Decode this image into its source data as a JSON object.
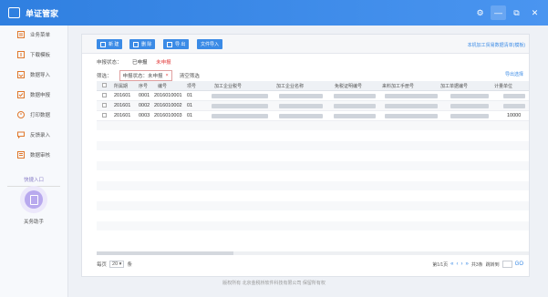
{
  "app": {
    "title": "单证管家",
    "colors": {
      "primary": "#3b8be6",
      "accent_red": "#e23b3b",
      "quick_purple": "#b8a9ee"
    }
  },
  "window_controls": [
    "gear-icon",
    "minimize-icon",
    "restore-icon",
    "close-icon"
  ],
  "sidebar": {
    "items": [
      {
        "label": "业务菜单",
        "icon": "menu-icon"
      },
      {
        "label": "下载模板",
        "icon": "download-icon"
      },
      {
        "label": "数据导入",
        "icon": "import-icon"
      },
      {
        "label": "数据申报",
        "icon": "declare-icon"
      },
      {
        "label": "打印数据",
        "icon": "print-icon"
      },
      {
        "label": "反馈录入",
        "icon": "feedback-icon"
      },
      {
        "label": "数据审核",
        "icon": "audit-icon"
      }
    ],
    "quick_entry_label": "快捷入口",
    "quick_item_label": "关务助手"
  },
  "toolbar": {
    "new_label": "新 建",
    "delete_label": "删 除",
    "export_label": "导 出",
    "import_label": "文件导入",
    "link_label": "本机加工贸易数据清单(模板)"
  },
  "status": {
    "label": "申报状态：",
    "declared": "已申报",
    "undeclared": "未申报"
  },
  "filter": {
    "label": "筛选：",
    "chip": "申报状态：未申报",
    "chip_close": "×",
    "clear": "清空筛选"
  },
  "export_link": "导出选择",
  "table": {
    "headers": [
      "所属期",
      "序号",
      "编号",
      "项号",
      "加工企业税号",
      "加工企业名称",
      "免税证明编号",
      "来料加工手册号",
      "加工单据编号",
      "计量单位"
    ],
    "rows": [
      {
        "period": "201601",
        "seq": "0001",
        "code": "2016010001",
        "item": "01",
        "unit": ""
      },
      {
        "period": "201601",
        "seq": "0002",
        "code": "2016010002",
        "item": "01",
        "unit": ""
      },
      {
        "period": "201601",
        "seq": "0003",
        "code": "2016010003",
        "item": "01",
        "unit": "10000"
      }
    ]
  },
  "pagination": {
    "per_page_label": "每页",
    "per_page_value": "20",
    "per_page_unit": "条",
    "page_info": "第1/1页",
    "jump_label": "共3条",
    "go_label": "跳转到",
    "go_button": "GO"
  },
  "footer": {
    "copyright": "版权所有 北京金税桥软件科技有限公司 保留所有权"
  }
}
